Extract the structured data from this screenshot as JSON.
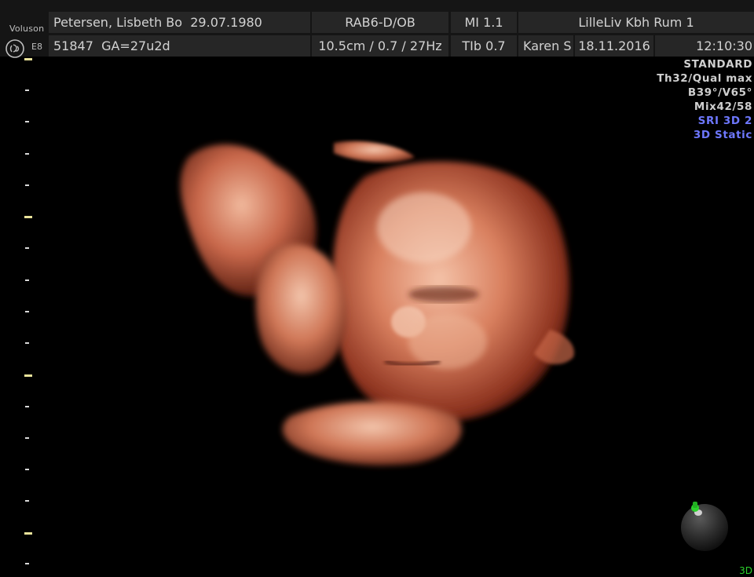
{
  "header": {
    "brand": "Voluson",
    "model": "E8",
    "patient_name": "Petersen, Lisbeth Bo",
    "dob": "29.07.1980",
    "probe": "RAB6-D/OB",
    "mi": "MI  1.1",
    "location": "LilleLiv Kbh Rum 1",
    "patient_id": "51847",
    "ga": "GA=27u2d",
    "depth_params": "10.5cm / 0.7 / 27Hz",
    "tib": "TIb  0.7",
    "operator": "Karen S",
    "date": "18.11.2016",
    "time": "12:10:30"
  },
  "params": {
    "preset": "STANDARD",
    "quality": "Th32/Qual max",
    "angles": "B39°/V65°",
    "mix": "Mix42/58",
    "sri": "SRI 3D 2",
    "mode": "3D Static"
  },
  "footer": {
    "mode_badge": "3D"
  },
  "colors": {
    "header_cell": "#262626",
    "accent_blue": "#6e78ff",
    "scale_major": "#e9e29a",
    "render_skin": "#c8674a",
    "orient_green": "#2bd12b"
  },
  "icons": [
    "ge-logo-icon",
    "orientation-sphere-icon"
  ]
}
